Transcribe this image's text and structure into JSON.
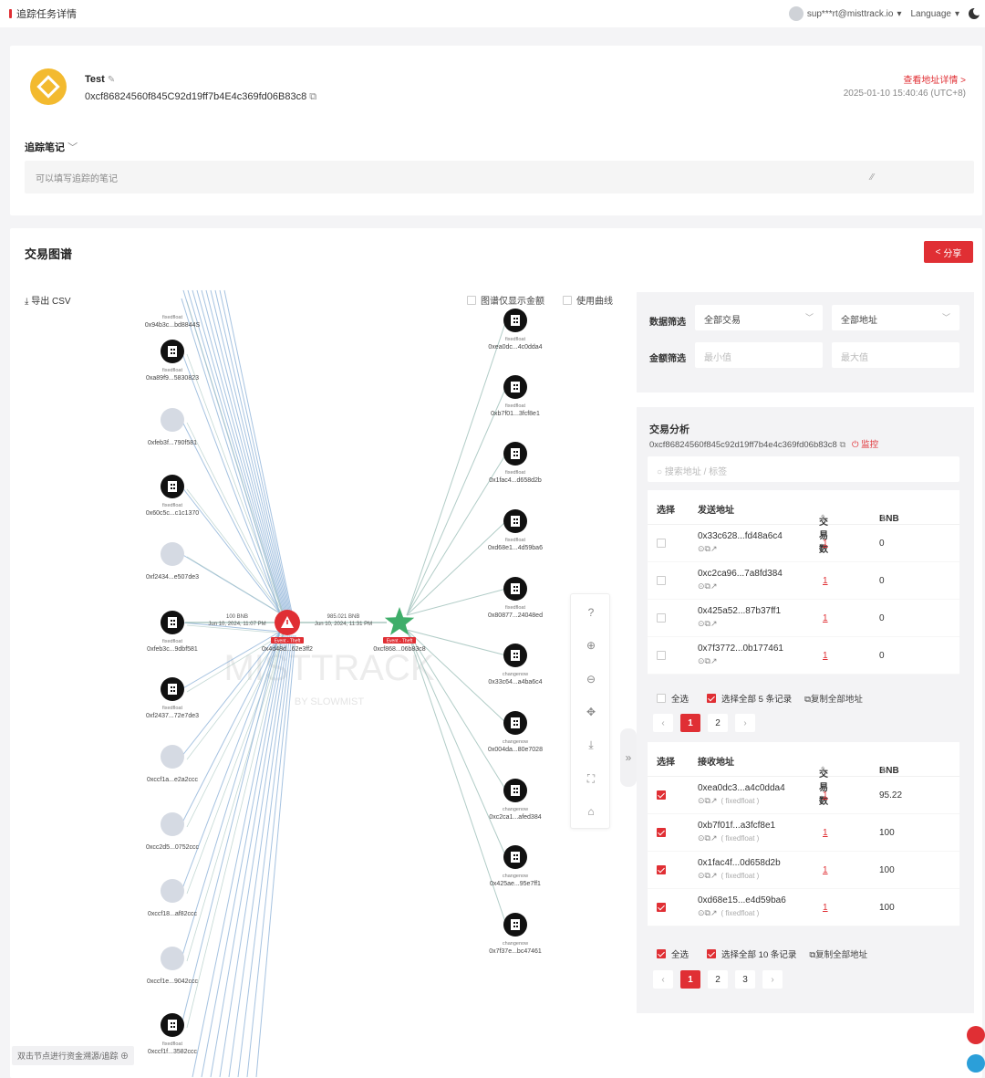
{
  "header": {
    "page_title": "追踪任务详情",
    "user_email": "sup***rt@misttrack.io",
    "language_label": "Language"
  },
  "task": {
    "name": "Test",
    "address": "0xcf86824560f845C92d19ff7b4E4c369fd06B83c8",
    "view_address_link": "查看地址详情 >",
    "datetime": "2025-01-10 15:40:46 (UTC+8)",
    "notes_label": "追踪笔记",
    "notes_placeholder": "可以填写追踪的笔记",
    "token_color": "#f3ba2f"
  },
  "graph": {
    "title": "交易图谱",
    "share_label": "分享",
    "export_csv_label": "导出 CSV",
    "option_amount_only": "图谱仅显示金额",
    "option_curve": "使用曲线",
    "hint": "双击节点进行资金溯源/追踪",
    "watermark": "MISTTRACK",
    "watermark_sub": "BY SLOWMIST",
    "left_nodes": [
      {
        "label": "0x94b3c...bd8844S",
        "tag": "fixedfloat",
        "type": "exchange"
      },
      {
        "label": "0xa89f9...5830823",
        "tag": "fixedfloat",
        "type": "exchange"
      },
      {
        "label": "0xfeb3f...790f581",
        "tag": "",
        "type": "plain"
      },
      {
        "label": "0x60c5c...c1c1370",
        "tag": "fixedfloat",
        "type": "exchange"
      },
      {
        "label": "0xf2434...e507de3",
        "tag": "",
        "type": "plain"
      },
      {
        "label": "0xfeb3c...9dbf581",
        "tag": "fixedfloat",
        "type": "exchange"
      },
      {
        "label": "0xf2437...72e7de3",
        "tag": "fixedfloat",
        "type": "exchange"
      },
      {
        "label": "0xccf1a...e2a2ccc",
        "tag": "",
        "type": "plain"
      },
      {
        "label": "0xcc2d5...0752ccc",
        "tag": "",
        "type": "plain"
      },
      {
        "label": "0xccf18...af82ccc",
        "tag": "",
        "type": "plain"
      },
      {
        "label": "0xccf1e...9042ccc",
        "tag": "",
        "type": "plain"
      },
      {
        "label": "0xccf1f...3582ccc",
        "tag": "fixedfloat",
        "type": "exchange"
      }
    ],
    "right_nodes": [
      {
        "label": "0xea0dc...4c0dda4",
        "tag": "fixedfloat"
      },
      {
        "label": "0xb7f01...3fcf8e1",
        "tag": "fixedfloat"
      },
      {
        "label": "0x1fac4...d658d2b",
        "tag": "fixedfloat"
      },
      {
        "label": "0xd68e1...4d59ba6",
        "tag": "fixedfloat"
      },
      {
        "label": "0x80877...24048ed",
        "tag": "fixedfloat"
      },
      {
        "label": "0x33c64...a4ba6c4",
        "tag": "changenow"
      },
      {
        "label": "0x004da...80e7028",
        "tag": "changenow"
      },
      {
        "label": "0xc2ca1...afed384",
        "tag": "changenow"
      },
      {
        "label": "0x425ae...95e7ff1",
        "tag": "changenow"
      },
      {
        "label": "0x7f37e...bc47461",
        "tag": "changenow"
      }
    ],
    "center_alert": {
      "label": "0x4d48d...62e3ff2",
      "badge": "Event - Theft"
    },
    "center_target": {
      "label": "0xcf868...06b83c8",
      "badge": "Event - Theft"
    },
    "main_edge": {
      "amount": "985.021 BNB",
      "time": "Jun 10, 2024, 11:31 PM"
    },
    "left_edge": {
      "amount": "100 BNB",
      "time": "Jun 10, 2024, 11:07 PM"
    },
    "colors": {
      "accent": "#e02f34",
      "target": "#3fae6a",
      "edge": "#8fb3d9"
    }
  },
  "filters": {
    "data_filter_label": "数据筛选",
    "tx_select": "全部交易",
    "addr_select": "全部地址",
    "amount_filter_label": "金额筛选",
    "min_placeholder": "最小值",
    "max_placeholder": "最大值"
  },
  "analysis": {
    "title": "交易分析",
    "address": "0xcf86824560f845c92d19ff7b4e4c369fd06b83c8",
    "monitor_label": "监控",
    "search_placeholder": "搜索地址 / 标签",
    "send_table": {
      "headers": {
        "select": "选择",
        "addr": "发送地址",
        "count": "交易数",
        "amount": "BNB"
      },
      "rows": [
        {
          "addr": "0x33c628...fd48a6c4",
          "tag": "",
          "count": "1",
          "amount": "0",
          "checked": false
        },
        {
          "addr": "0xc2ca96...7a8fd384",
          "tag": "",
          "count": "1",
          "amount": "0",
          "checked": false
        },
        {
          "addr": "0x425a52...87b37ff1",
          "tag": "",
          "count": "1",
          "amount": "0",
          "checked": false
        },
        {
          "addr": "0x7f3772...0b177461",
          "tag": "",
          "count": "1",
          "amount": "0",
          "checked": false
        }
      ],
      "select_all": "全选",
      "select_all_records": "选择全部 5 条记录",
      "copy_all": "复制全部地址",
      "pages": [
        "1",
        "2"
      ]
    },
    "recv_table": {
      "headers": {
        "select": "选择",
        "addr": "接收地址",
        "count": "交易数",
        "amount": "BNB"
      },
      "rows": [
        {
          "addr": "0xea0dc3...a4c0dda4",
          "tag": "( fixedfloat )",
          "count": "1",
          "amount": "95.22",
          "checked": true
        },
        {
          "addr": "0xb7f01f...a3fcf8e1",
          "tag": "( fixedfloat )",
          "count": "1",
          "amount": "100",
          "checked": true
        },
        {
          "addr": "0x1fac4f...0d658d2b",
          "tag": "( fixedfloat )",
          "count": "1",
          "amount": "100",
          "checked": true
        },
        {
          "addr": "0xd68e15...e4d59ba6",
          "tag": "( fixedfloat )",
          "count": "1",
          "amount": "100",
          "checked": true
        }
      ],
      "select_all": "全选",
      "select_all_records": "选择全部 10 条记录",
      "copy_all": "复制全部地址",
      "pages": [
        "1",
        "2",
        "3"
      ]
    }
  }
}
